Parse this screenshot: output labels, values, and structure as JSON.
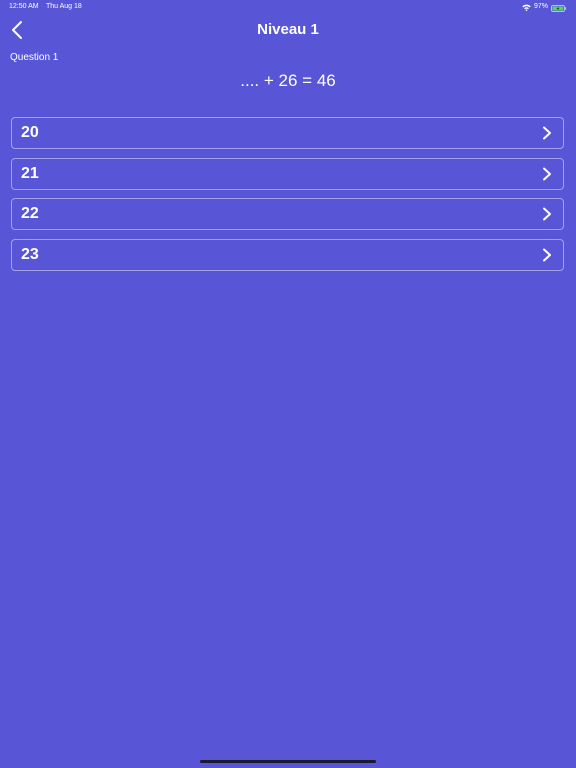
{
  "status_bar": {
    "time": "12:50 AM",
    "date": "Thu Aug 18",
    "battery_percent": "97%",
    "battery_level": 0.97,
    "battery_color": "#4CD964"
  },
  "nav": {
    "title": "Niveau 1",
    "back_icon": "chevron-left-icon"
  },
  "question": {
    "label": "Question 1",
    "equation": ".... + 26 = 46"
  },
  "answers": [
    {
      "label": "20",
      "icon": "chevron-right-icon"
    },
    {
      "label": "21",
      "icon": "chevron-right-icon"
    },
    {
      "label": "22",
      "icon": "chevron-right-icon"
    },
    {
      "label": "23",
      "icon": "chevron-right-icon"
    }
  ],
  "colors": {
    "background": "#5856D6",
    "text": "#FFFFFF"
  }
}
